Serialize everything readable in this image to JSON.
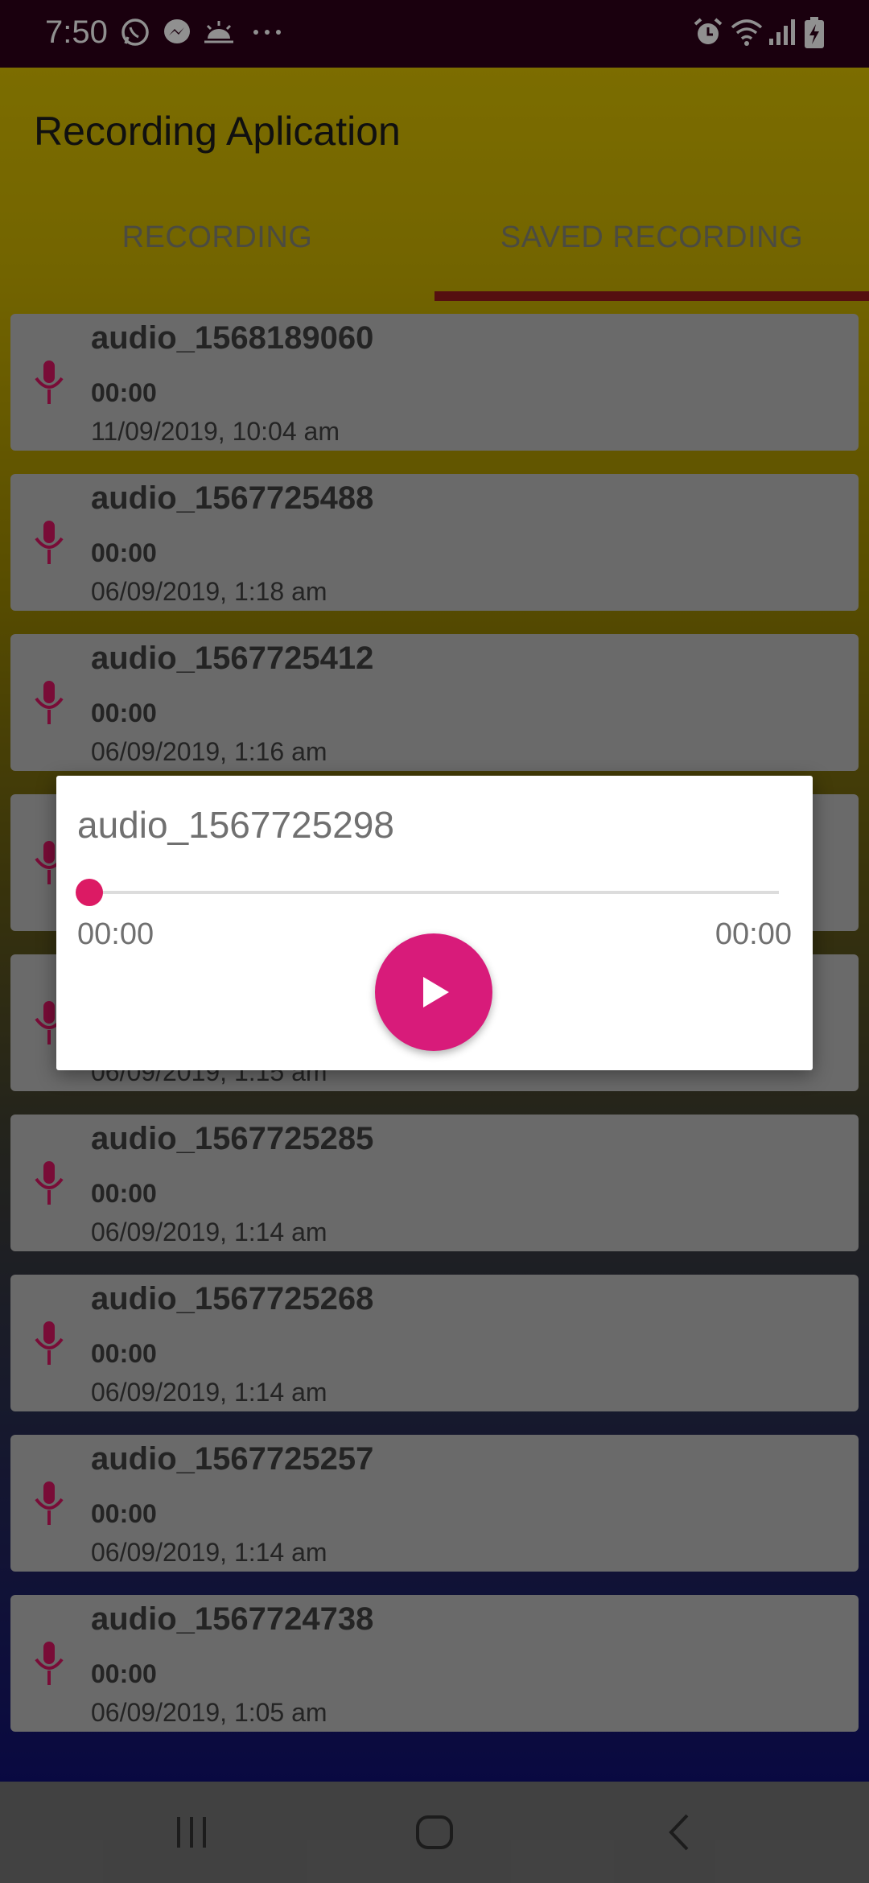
{
  "status_bar": {
    "time": "7:50",
    "left_icons": [
      "whatsapp-icon",
      "messenger-icon",
      "weather-icon",
      "more-dots-icon"
    ],
    "right_icons": [
      "alarm-icon",
      "wifi-icon",
      "signal-icon",
      "battery-charging-icon"
    ]
  },
  "app": {
    "title": "Recording Aplication",
    "tabs": [
      {
        "label": "RECORDING",
        "selected": false
      },
      {
        "label": "SAVED RECORDING",
        "selected": true
      }
    ],
    "accent_color": "#d81b7a"
  },
  "recordings": [
    {
      "name": "audio_1568189060",
      "duration": "00:00",
      "date": "11/09/2019, 10:04 am"
    },
    {
      "name": "audio_1567725488",
      "duration": "00:00",
      "date": "06/09/2019, 1:18 am"
    },
    {
      "name": "audio_1567725412",
      "duration": "00:00",
      "date": "06/09/2019, 1:16 am"
    },
    {
      "name": "",
      "duration": "",
      "date": ""
    },
    {
      "name": "",
      "duration": "",
      "date": "06/09/2019, 1:15 am"
    },
    {
      "name": "audio_1567725285",
      "duration": "00:00",
      "date": "06/09/2019, 1:14 am"
    },
    {
      "name": "audio_1567725268",
      "duration": "00:00",
      "date": "06/09/2019, 1:14 am"
    },
    {
      "name": "audio_1567725257",
      "duration": "00:00",
      "date": "06/09/2019, 1:14 am"
    },
    {
      "name": "audio_1567724738",
      "duration": "00:00",
      "date": "06/09/2019, 1:05 am"
    }
  ],
  "dialog": {
    "title": "audio_1567725298",
    "current_time": "00:00",
    "total_time": "00:00",
    "progress": 0
  },
  "nav_bar": {
    "buttons": [
      "recent-apps-icon",
      "home-icon",
      "back-icon"
    ]
  }
}
